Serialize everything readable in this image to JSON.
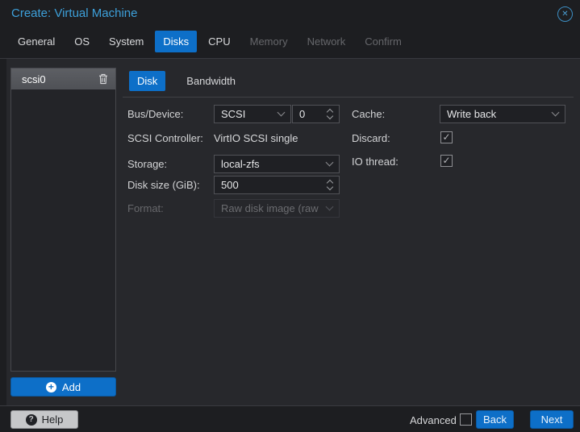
{
  "window": {
    "title": "Create: Virtual Machine"
  },
  "tabs": [
    {
      "label": "General",
      "state": "normal"
    },
    {
      "label": "OS",
      "state": "normal"
    },
    {
      "label": "System",
      "state": "normal"
    },
    {
      "label": "Disks",
      "state": "active"
    },
    {
      "label": "CPU",
      "state": "normal"
    },
    {
      "label": "Memory",
      "state": "disabled"
    },
    {
      "label": "Network",
      "state": "disabled"
    },
    {
      "label": "Confirm",
      "state": "disabled"
    }
  ],
  "disk_panel": {
    "items": [
      {
        "label": "scsi0",
        "selected": true
      }
    ],
    "add_button": "Add"
  },
  "disk_tabs": [
    {
      "label": "Disk",
      "active": true
    },
    {
      "label": "Bandwidth",
      "active": false
    }
  ],
  "form": {
    "bus_device": {
      "label": "Bus/Device:",
      "value": "SCSI",
      "number": "0"
    },
    "scsi_controller": {
      "label": "SCSI Controller:",
      "value": "VirtIO SCSI single"
    },
    "storage": {
      "label": "Storage:",
      "value": "local-zfs"
    },
    "disk_size": {
      "label": "Disk size (GiB):",
      "value": "500"
    },
    "format": {
      "label": "Format:",
      "value": "Raw disk image (raw",
      "disabled": true
    },
    "cache": {
      "label": "Cache:",
      "value": "Write back"
    },
    "discard": {
      "label": "Discard:",
      "checked": true
    },
    "io_thread": {
      "label": "IO thread:",
      "checked": true
    }
  },
  "footer": {
    "help": "Help",
    "advanced": "Advanced",
    "advanced_checked": false,
    "back": "Back",
    "next": "Next"
  },
  "colors": {
    "accent": "#0d6fc8",
    "title_text": "#3da0da",
    "content_bg": "#27282c",
    "window_bg": "#1d1e21",
    "selected_item_bg": "#55575c"
  }
}
